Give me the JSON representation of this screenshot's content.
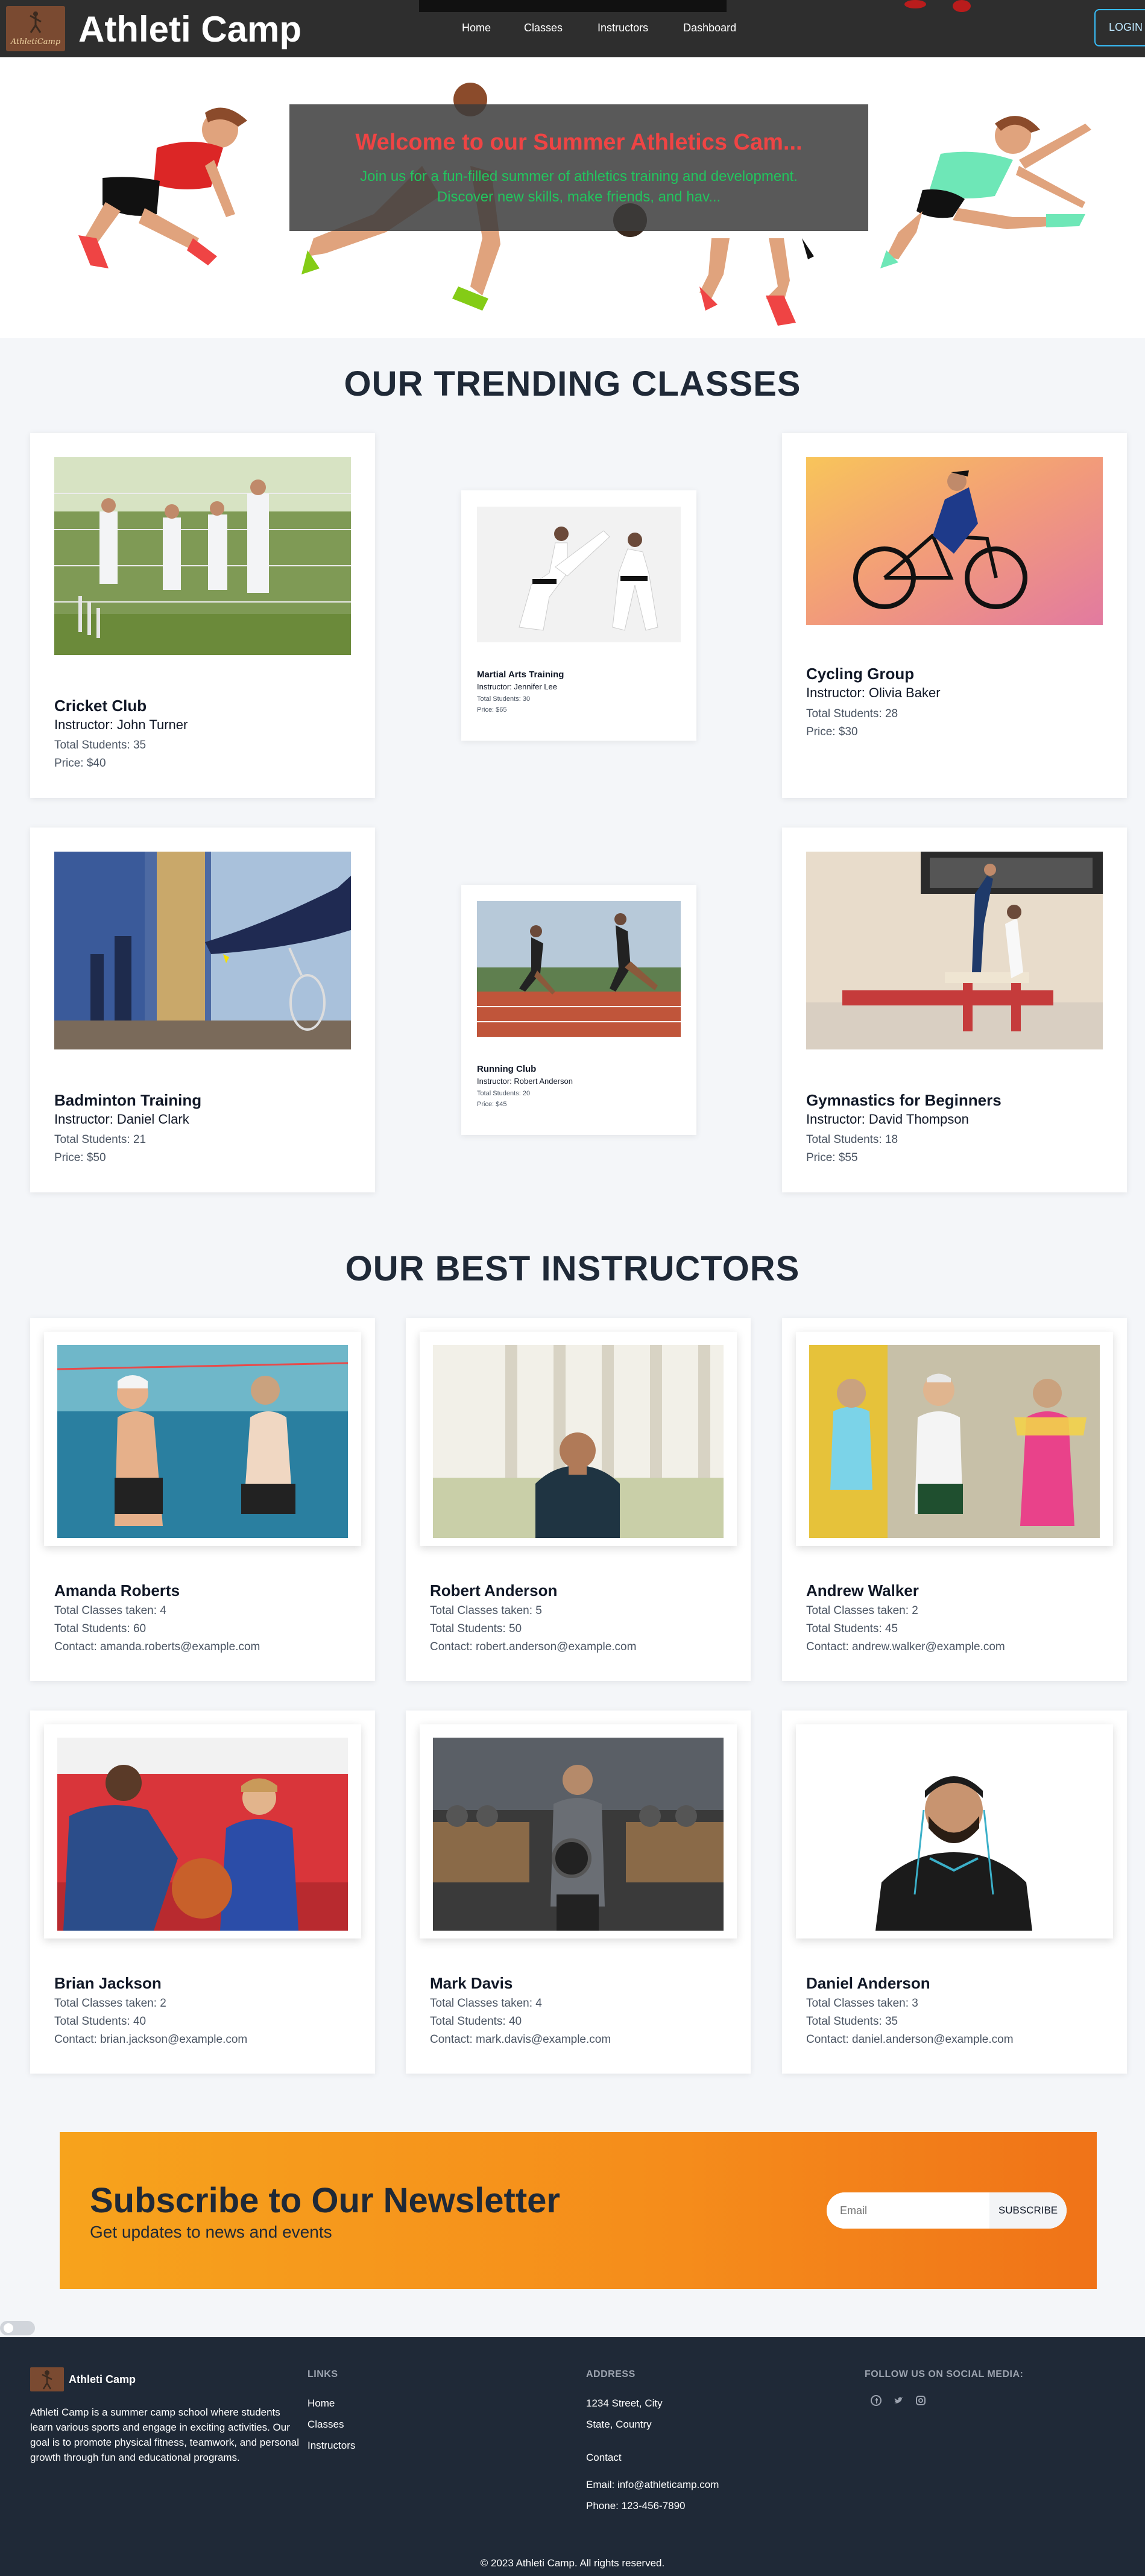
{
  "nav": {
    "brand": "Athleti Camp",
    "logo_text": "AthletiCamp",
    "links": [
      "Home",
      "Classes",
      "Instructors",
      "Dashboard"
    ],
    "login": "LOGIN"
  },
  "hero": {
    "title": "Welcome to our Summer Athletics Cam...",
    "text_line1": "Join us for a fun-filled summer of athletics training and development.",
    "text_line2": "Discover new skills, make friends, and hav..."
  },
  "classes": {
    "heading": "OUR TRENDING CLASSES",
    "items": [
      {
        "title": "Cricket Club",
        "instructor": "Instructor: John Turner",
        "students": "Total Students: 35",
        "price": "Price: $40"
      },
      {
        "title": "Martial Arts Training",
        "instructor": "Instructor: Jennifer Lee",
        "students": "Total Students: 30",
        "price": "Price: $65"
      },
      {
        "title": "Cycling Group",
        "instructor": "Instructor: Olivia Baker",
        "students": "Total Students: 28",
        "price": "Price: $30"
      },
      {
        "title": "Badminton Training",
        "instructor": "Instructor: Daniel Clark",
        "students": "Total Students: 21",
        "price": "Price: $50"
      },
      {
        "title": "Running Club",
        "instructor": "Instructor: Robert Anderson",
        "students": "Total Students: 20",
        "price": "Price: $45"
      },
      {
        "title": "Gymnastics for Beginners",
        "instructor": "Instructor: David Thompson",
        "students": "Total Students: 18",
        "price": "Price: $55"
      }
    ]
  },
  "instructors": {
    "heading": "OUR BEST INSTRUCTORS",
    "items": [
      {
        "name": "Amanda Roberts",
        "classes": "Total Classes taken: 4",
        "students": "Total Students: 60",
        "contact": "Contact: amanda.roberts@example.com"
      },
      {
        "name": "Robert Anderson",
        "classes": "Total Classes taken: 5",
        "students": "Total Students: 50",
        "contact": "Contact: robert.anderson@example.com"
      },
      {
        "name": "Andrew Walker",
        "classes": "Total Classes taken: 2",
        "students": "Total Students: 45",
        "contact": "Contact: andrew.walker@example.com"
      },
      {
        "name": "Brian Jackson",
        "classes": "Total Classes taken: 2",
        "students": "Total Students: 40",
        "contact": "Contact: brian.jackson@example.com"
      },
      {
        "name": "Mark Davis",
        "classes": "Total Classes taken: 4",
        "students": "Total Students: 40",
        "contact": "Contact: mark.davis@example.com"
      },
      {
        "name": "Daniel Anderson",
        "classes": "Total Classes taken: 3",
        "students": "Total Students: 35",
        "contact": "Contact: daniel.anderson@example.com"
      }
    ]
  },
  "newsletter": {
    "title": "Subscribe to Our Newsletter",
    "subtitle": "Get updates to news and events",
    "placeholder": "Email",
    "button": "SUBSCRIBE"
  },
  "footer": {
    "brand": "Athleti Camp",
    "about": "Athleti Camp is a summer camp school where students learn various sports and engage in exciting activities. Our goal is to promote physical fitness, teamwork, and personal growth through fun and educational programs.",
    "links_heading": "LINKS",
    "links": [
      "Home",
      "Classes",
      "Instructors"
    ],
    "address_heading": "ADDRESS",
    "address_line1": "1234 Street, City",
    "address_line2": "State, Country",
    "contact_label": "Contact",
    "email": "Email: info@athleticamp.com",
    "phone": "Phone: 123-456-7890",
    "social_heading": "FOLLOW US ON SOCIAL MEDIA:",
    "social_icons": [
      "facebook-icon",
      "twitter-icon",
      "instagram-icon"
    ],
    "copyright": "© 2023 Athleti Camp. All rights reserved."
  }
}
